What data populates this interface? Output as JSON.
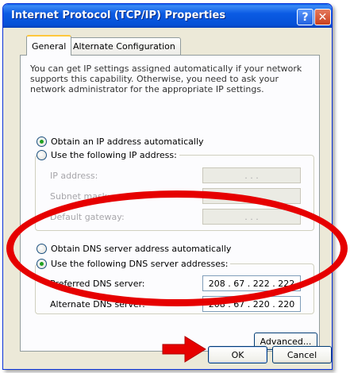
{
  "window": {
    "title": "Internet Protocol (TCP/IP) Properties"
  },
  "titlebar": {
    "help_label": "?",
    "close_label": "✕"
  },
  "tabs": [
    {
      "label": "General",
      "active": true
    },
    {
      "label": "Alternate Configuration",
      "active": false
    }
  ],
  "intro_text": "You can get IP settings assigned automatically if your network supports this capability. Otherwise, you need to ask your network administrator for the appropriate IP settings.",
  "ip_section": {
    "auto_label": "Obtain an IP address automatically",
    "manual_label": "Use the following IP address:",
    "auto_selected": true,
    "fields": [
      {
        "label": "IP address:",
        "value": ".       .       ."
      },
      {
        "label": "Subnet mask:",
        "value": ".       .       ."
      },
      {
        "label": "Default gateway:",
        "value": ".       .       ."
      }
    ]
  },
  "dns_section": {
    "auto_label": "Obtain DNS server address automatically",
    "manual_label": "Use the following DNS server addresses:",
    "manual_selected": true,
    "fields": [
      {
        "label": "Preferred DNS server:",
        "value": "208 . 67 . 222 . 222"
      },
      {
        "label": "Alternate DNS server:",
        "value": "208 . 67 . 220 . 220"
      }
    ]
  },
  "buttons": {
    "advanced": "Advanced...",
    "ok": "OK",
    "cancel": "Cancel"
  },
  "colors": {
    "annotation": "#e60000",
    "titlebar": "#0550d6"
  },
  "icons": {
    "help": "help-icon",
    "close": "close-icon",
    "arrow": "red-arrow-annotation"
  }
}
